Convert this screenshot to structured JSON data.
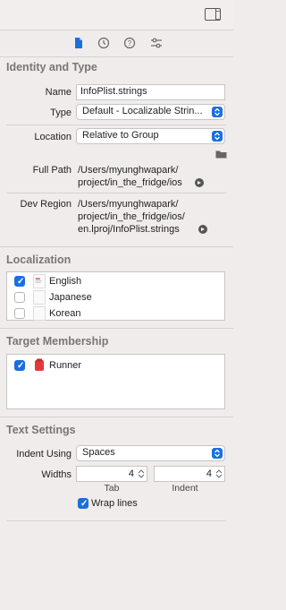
{
  "identity": {
    "title": "Identity and Type",
    "name_label": "Name",
    "name_value": "InfoPlist.strings",
    "type_label": "Type",
    "type_value": "Default - Localizable Strin...",
    "location_label": "Location",
    "location_value": "Relative to Group",
    "fullpath_label": "Full Path",
    "fullpath_line1": "/Users/myunghwapark/",
    "fullpath_line2": "project/in_the_fridge/ios",
    "devregion_label": "Dev Region",
    "devregion_line1": "/Users/myunghwapark/",
    "devregion_line2": "project/in_the_fridge/ios/",
    "devregion_line3": "en.lproj/InfoPlist.strings"
  },
  "localization": {
    "title": "Localization",
    "items": [
      {
        "label": "English",
        "checked": true
      },
      {
        "label": "Japanese",
        "checked": false
      },
      {
        "label": "Korean",
        "checked": false
      }
    ]
  },
  "membership": {
    "title": "Target Membership",
    "items": [
      {
        "label": "Runner",
        "checked": true
      }
    ]
  },
  "text_settings": {
    "title": "Text Settings",
    "indent_label": "Indent Using",
    "indent_value": "Spaces",
    "widths_label": "Widths",
    "tab_value": "4",
    "indent_width_value": "4",
    "tab_caption": "Tab",
    "indent_caption": "Indent",
    "wrap_label": "Wrap lines",
    "wrap_checked": true
  },
  "colors": {
    "accent": "#1a6fde",
    "background": "#f1ecec",
    "section_title": "#7a7676"
  }
}
